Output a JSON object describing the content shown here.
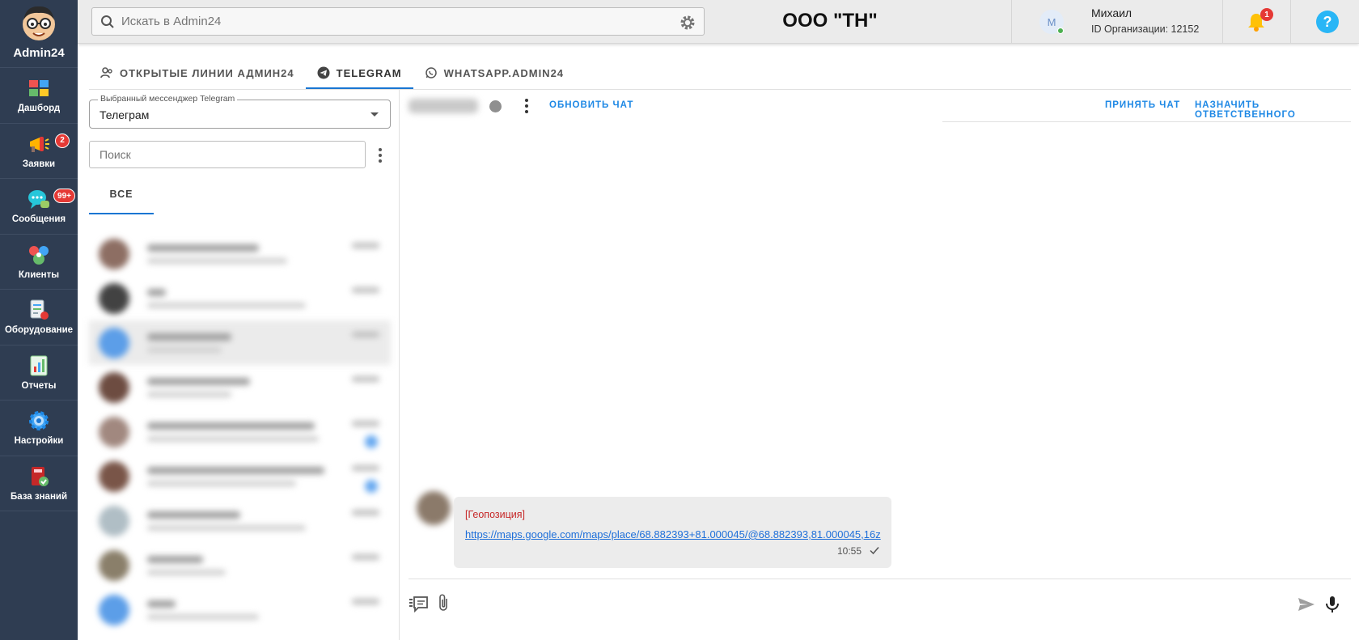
{
  "sidebar": {
    "brand": "Admin24",
    "items": [
      {
        "label": "Дашборд",
        "badge": ""
      },
      {
        "label": "Заявки",
        "badge": "2"
      },
      {
        "label": "Сообщения",
        "badge": "99+"
      },
      {
        "label": "Клиенты",
        "badge": ""
      },
      {
        "label": "Оборудование",
        "badge": ""
      },
      {
        "label": "Отчеты",
        "badge": ""
      },
      {
        "label": "Настройки",
        "badge": ""
      },
      {
        "label": "База знаний",
        "badge": ""
      }
    ]
  },
  "topbar": {
    "search_placeholder": "Искать в Admin24",
    "org_title": "ООО \"ТН\"",
    "user": {
      "initial": "М",
      "name": "Михаил",
      "org_id": "ID Организации: 12152"
    },
    "notifications_count": "1",
    "help_label": "?"
  },
  "tabs": [
    {
      "label": "ОТКРЫТЫЕ ЛИНИИ АДМИН24",
      "icon": "users-icon"
    },
    {
      "label": "TELEGRAM",
      "icon": "telegram-icon",
      "active": true
    },
    {
      "label": "WHATSAPP.ADMIN24",
      "icon": "whatsapp-icon"
    }
  ],
  "left_panel": {
    "messenger_legend": "Выбранный мессенджер Telegram",
    "messenger_value": "Телеграм",
    "search_placeholder": "Поиск",
    "filter_tab": "ВСЕ"
  },
  "chat": {
    "actions": {
      "refresh": "ОБНОВИТЬ ЧАТ",
      "accept": "ПРИНЯТЬ ЧАТ",
      "assign": "НАЗНАЧИТЬ ОТВЕТСТВЕННОГО"
    },
    "message": {
      "label": "[Геопозиция]",
      "url": "https://maps.google.com/maps/place/68.882393+81.000045/@68.882393,81.000045,16z",
      "time": "10:55"
    }
  },
  "colors": {
    "sidebar_bg": "#2f3d52",
    "accent": "#1976d2",
    "badge": "#e53935",
    "geo_label": "#c62828"
  }
}
